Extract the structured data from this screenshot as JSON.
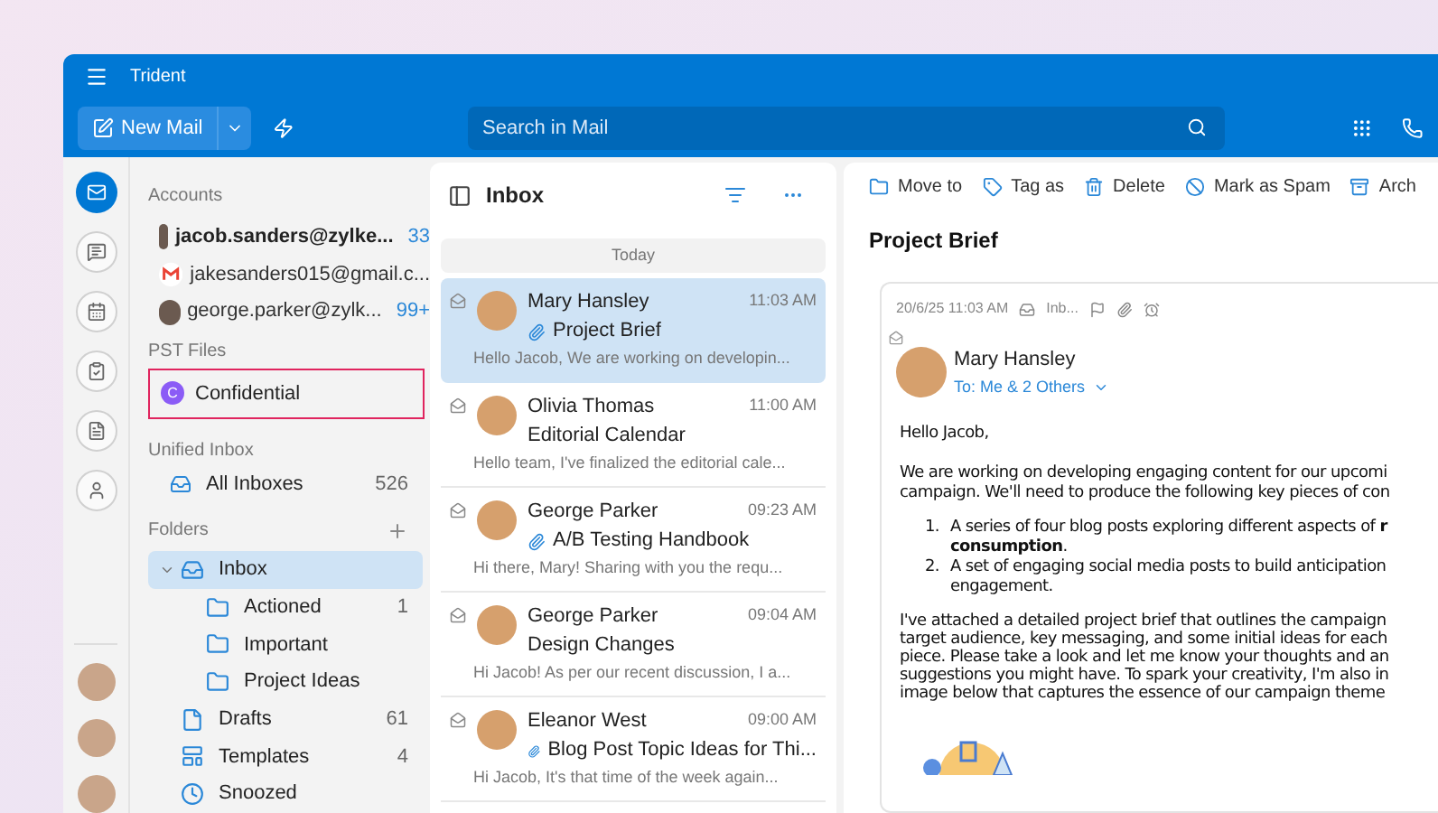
{
  "window": {
    "title": "Trident"
  },
  "toolbar": {
    "new_mail": "New Mail",
    "search": {
      "placeholder": "Search in Mail"
    }
  },
  "nav_rail": {
    "items": [
      {
        "kind": "mail",
        "selected": true
      },
      {
        "kind": "chat",
        "selected": false
      },
      {
        "kind": "calendar",
        "selected": false
      },
      {
        "kind": "tasks",
        "selected": false
      },
      {
        "kind": "notes",
        "selected": false
      },
      {
        "kind": "contacts",
        "selected": false
      }
    ]
  },
  "folders": {
    "accounts_header": "Accounts",
    "accounts": [
      {
        "kind": "avatar",
        "email": "jacob.sanders@zylke...",
        "count": "33",
        "bold": true
      },
      {
        "kind": "gmail",
        "email": "jakesanders015@gmail.c...",
        "bold": false
      },
      {
        "kind": "avatar",
        "email": "george.parker@zylk...",
        "count": "99+",
        "bold": false
      }
    ],
    "pst_header": "PST Files",
    "pst": {
      "initial": "C",
      "name": "Confidential",
      "color": "#8b5cf6",
      "focused": true
    },
    "unified_header": "Unified Inbox",
    "unified": [
      {
        "label": "All Inboxes",
        "count": "526"
      }
    ],
    "folders_header": "Folders",
    "items": [
      {
        "kind": "inbox",
        "label": "Inbox",
        "selected": true,
        "expanded": true,
        "children": [
          {
            "kind": "folder",
            "label": "Actioned",
            "count": "1",
            "selected": false
          },
          {
            "kind": "folder",
            "label": "Important",
            "selected": false
          },
          {
            "kind": "folder",
            "label": "Project Ideas",
            "selected": false
          }
        ]
      },
      {
        "kind": "drafts",
        "label": "Drafts",
        "count": "61",
        "selected": false
      },
      {
        "kind": "templates",
        "label": "Templates",
        "count": "4",
        "selected": false
      },
      {
        "kind": "snoozed",
        "label": "Snoozed",
        "selected": false
      }
    ]
  },
  "list": {
    "title": "Inbox",
    "group": "Today",
    "messages": [
      {
        "sender": "Mary Hansley",
        "time": "11:03 AM",
        "subject": "Project Brief",
        "attachment": true,
        "preview": "Hello Jacob, We are working on developin...",
        "selected": true
      },
      {
        "sender": "Olivia Thomas",
        "time": "11:00 AM",
        "subject": "Editorial Calendar",
        "attachment": false,
        "preview": "Hello team, I've finalized the editorial cale...",
        "selected": false
      },
      {
        "sender": "George Parker",
        "time": "09:23 AM",
        "subject": "A/B Testing Handbook",
        "attachment": true,
        "preview": "Hi there, Mary! Sharing with you the requ...",
        "selected": false
      },
      {
        "sender": "George Parker",
        "time": "09:04 AM",
        "subject": "Design Changes",
        "attachment": false,
        "preview": "Hi Jacob! As per our recent discussion, I a...",
        "selected": false
      },
      {
        "sender": "Eleanor West",
        "time": "09:00 AM",
        "subject": "Blog Post Topic Ideas for Thi...",
        "attachment": true,
        "preview": "Hi Jacob, It's that time of the week again...",
        "selected": false
      }
    ]
  },
  "reader": {
    "actions": [
      {
        "kind": "move",
        "label": "Move to"
      },
      {
        "kind": "tag",
        "label": "Tag as"
      },
      {
        "kind": "delete",
        "label": "Delete"
      },
      {
        "kind": "spam",
        "label": "Mark as Spam"
      },
      {
        "kind": "archive",
        "label": "Arch"
      }
    ],
    "subject": "Project Brief",
    "date": "20/6/25 11:03 AM",
    "folder": "Inb...",
    "sender": "Mary Hansley",
    "to": "To: Me & 2 Others",
    "greeting": "Hello Jacob,",
    "para1": [
      "We are working on developing engaging content for our upcomi",
      "campaign. We'll need to produce the following key pieces of con"
    ],
    "list": [
      {
        "number": "1.",
        "lines": [
          "A series of four blog posts exploring different aspects of **r**",
          "**consumption**."
        ]
      },
      {
        "number": "2.",
        "lines": [
          "A set of engaging social media posts to build anticipation",
          "engagement."
        ]
      }
    ],
    "para2": [
      "I've attached a detailed project brief that outlines the campaign",
      "target audience, key messaging, and some initial ideas for each",
      "piece. Please take a look and let me know your thoughts and an",
      "suggestions you might have. To spark your creativity, I'm also in",
      "image below that captures the essence of our campaign theme"
    ]
  }
}
